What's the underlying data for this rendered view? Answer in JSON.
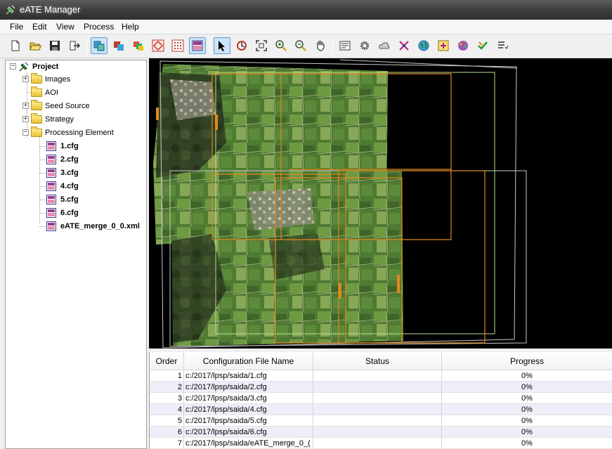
{
  "window": {
    "title": "eATE Manager",
    "icon": "satellite-icon"
  },
  "menu": [
    {
      "label": "File"
    },
    {
      "label": "Edit"
    },
    {
      "label": "View"
    },
    {
      "label": "Process"
    },
    {
      "label": "Help"
    }
  ],
  "toolbar": {
    "buttons": [
      {
        "name": "new-file-icon"
      },
      {
        "name": "open-folder-icon"
      },
      {
        "name": "save-icon"
      },
      {
        "name": "export-icon"
      },
      {
        "name": "layer-images-icon",
        "active": true
      },
      {
        "name": "layer-color-icon"
      },
      {
        "name": "layer-rgb-icon"
      },
      {
        "name": "aoi-diamond-icon"
      },
      {
        "name": "grid-points-icon"
      },
      {
        "name": "tile-layout-icon",
        "active": true
      },
      {
        "name": "pointer-icon",
        "active": true
      },
      {
        "name": "rotate-icon"
      },
      {
        "name": "zoom-extent-icon"
      },
      {
        "name": "zoom-in-icon"
      },
      {
        "name": "zoom-out-icon"
      },
      {
        "name": "pan-hand-icon"
      },
      {
        "name": "properties-icon"
      },
      {
        "name": "settings-gear-icon"
      },
      {
        "name": "cloud-icon"
      },
      {
        "name": "tie-points-icon"
      },
      {
        "name": "globe-icon"
      },
      {
        "name": "add-layer-icon"
      },
      {
        "name": "palette-icon"
      },
      {
        "name": "check-icon"
      },
      {
        "name": "list-icon"
      }
    ]
  },
  "tree": {
    "root": {
      "label": "Project"
    },
    "folders": [
      {
        "label": "Images",
        "expander": "+"
      },
      {
        "label": "AOI",
        "expander": ""
      },
      {
        "label": "Seed Source",
        "expander": "+"
      },
      {
        "label": "Strategy",
        "expander": "+"
      },
      {
        "label": "Processing Element",
        "expander": "−"
      }
    ],
    "files": [
      {
        "label": "1.cfg"
      },
      {
        "label": "2.cfg"
      },
      {
        "label": "3.cfg"
      },
      {
        "label": "4.cfg"
      },
      {
        "label": "5.cfg"
      },
      {
        "label": "6.cfg"
      },
      {
        "label": "eATE_merge_0_0.xml"
      }
    ]
  },
  "table": {
    "columns": [
      {
        "label": "Order"
      },
      {
        "label": "Configuration File Name"
      },
      {
        "label": "Status"
      },
      {
        "label": "Progress"
      }
    ],
    "rows": [
      {
        "order": "1",
        "file": "c:/2017/lpsp/saida/1.cfg",
        "status": "",
        "progress": "0%"
      },
      {
        "order": "2",
        "file": "c:/2017/lpsp/saida/2.cfg",
        "status": "",
        "progress": "0%"
      },
      {
        "order": "3",
        "file": "c:/2017/lpsp/saida/3.cfg",
        "status": "",
        "progress": "0%"
      },
      {
        "order": "4",
        "file": "c:/2017/lpsp/saida/4.cfg",
        "status": "",
        "progress": "0%"
      },
      {
        "order": "5",
        "file": "c:/2017/lpsp/saida/5.cfg",
        "status": "",
        "progress": "0%"
      },
      {
        "order": "6",
        "file": "c:/2017/lpsp/saida/6.cfg",
        "status": "",
        "progress": "0%"
      },
      {
        "order": "7",
        "file": "c:/2017/lpsp/saida/eATE_merge_0_(",
        "status": "",
        "progress": "0%"
      }
    ]
  },
  "colors": {
    "footprint_orange": "#e08a1e",
    "footprint_green": "#b8e08a",
    "footprint_white": "#c8c8c8",
    "map_background": "#000000"
  }
}
